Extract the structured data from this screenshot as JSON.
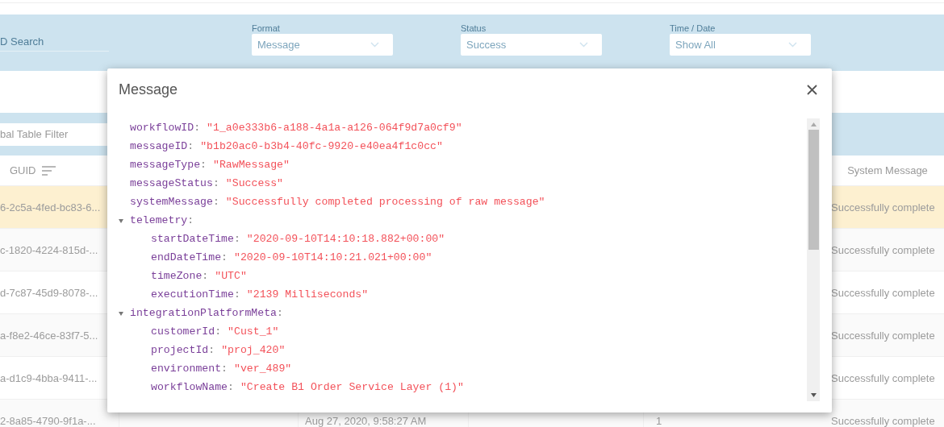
{
  "filters": {
    "search": {
      "label": "D Search"
    },
    "dropdowns": [
      {
        "label": "Format",
        "value": "Message"
      },
      {
        "label": "Status",
        "value": "Success"
      },
      {
        "label": "Time / Date",
        "value": "Show All"
      }
    ]
  },
  "table_filter": {
    "placeholder": "bal Table Filter"
  },
  "table": {
    "columns": [
      {
        "label": "GUID",
        "sortable": true
      },
      {
        "label": "System Message",
        "sortable": false
      }
    ],
    "rows": [
      {
        "guid": "6-2c5a-4fed-bc83-6...",
        "system_message": "Successfully complete",
        "selected": true
      },
      {
        "guid": "c-1820-4224-815d-...",
        "system_message": "Successfully complete",
        "selected": false
      },
      {
        "guid": "d-7c87-45d9-8078-...",
        "system_message": "Successfully complete",
        "selected": false
      },
      {
        "guid": "a-f8e2-46ce-83f7-5...",
        "system_message": "Successfully complete",
        "selected": false
      },
      {
        "guid": "a-d1c9-4bba-9411-...",
        "system_message": "Successfully complete",
        "selected": false
      },
      {
        "guid": "2-8a85-4790-9f1a-...",
        "date": "Aug 27, 2020, 9:58:27 AM",
        "column_5": "1",
        "system_message": "Successfully complete",
        "selected": false
      }
    ]
  },
  "dialog": {
    "title": "Message",
    "separator": ":",
    "entries": [
      {
        "key": "workflowID",
        "value": "\"1_a0e333b6-a188-4a1a-a126-064f9d7a0cf9\""
      },
      {
        "key": "messageID",
        "value": "\"b1b20ac0-b3b4-40fc-9920-e40ea4f1c0cc\""
      },
      {
        "key": "messageType",
        "value": "\"RawMessage\""
      },
      {
        "key": "messageStatus",
        "value": "\"Success\""
      },
      {
        "key": "systemMessage",
        "value": "\"Successfully completed processing of raw message\""
      },
      {
        "key": "telemetry",
        "expanded": true,
        "children": [
          {
            "key": "startDateTime",
            "value": "\"2020-09-10T14:10:18.882+00:00\""
          },
          {
            "key": "endDateTime",
            "value": "\"2020-09-10T14:10:21.021+00:00\""
          },
          {
            "key": "timeZone",
            "value": "\"UTC\""
          },
          {
            "key": "executionTime",
            "value": "\"2139 Milliseconds\""
          }
        ]
      },
      {
        "key": "integrationPlatformMeta",
        "expanded": true,
        "children": [
          {
            "key": "customerId",
            "value": "\"Cust_1\""
          },
          {
            "key": "projectId",
            "value": "\"proj_420\""
          },
          {
            "key": "environment",
            "value": "\"ver_489\""
          },
          {
            "key": "workflowName",
            "value": "\"Create B1 Order Service Layer (1)\""
          }
        ]
      }
    ]
  }
}
